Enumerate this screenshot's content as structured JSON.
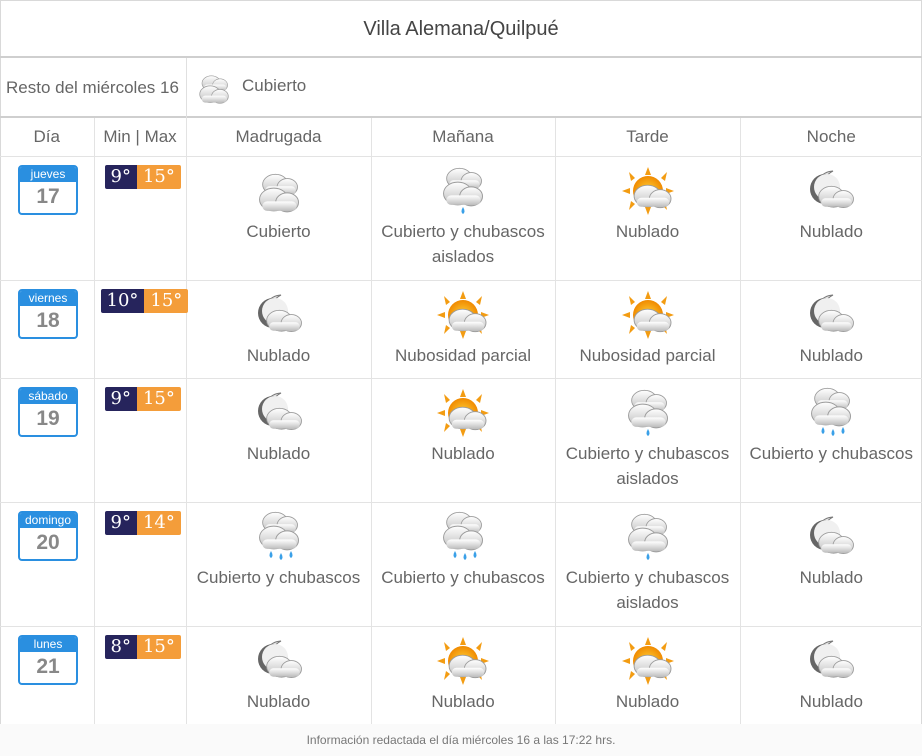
{
  "title": "Villa Alemana/Quilpué",
  "current": {
    "label": "Resto del miércoles 16",
    "condition": "Cubierto",
    "icon": "cloud-icon"
  },
  "headers": {
    "day": "Día",
    "minmax": "Min | Max",
    "madrugada": "Madrugada",
    "manana": "Mañana",
    "tarde": "Tarde",
    "noche": "Noche"
  },
  "colors": {
    "calendar": "#2a8fe0",
    "min_temp": "#26245c",
    "max_temp": "#f49d3a"
  },
  "days": [
    {
      "weekday": "jueves",
      "day": "17",
      "min": "9°",
      "max": "15°",
      "periods": [
        {
          "condition": "Cubierto",
          "icon": "cloud-icon"
        },
        {
          "condition": "Cubierto y chubascos aislados",
          "icon": "cloud-drizzle-icon"
        },
        {
          "condition": "Nublado",
          "icon": "sun-cloud-icon"
        },
        {
          "condition": "Nublado",
          "icon": "moon-cloud-icon"
        }
      ]
    },
    {
      "weekday": "viernes",
      "day": "18",
      "min": "10°",
      "max": "15°",
      "periods": [
        {
          "condition": "Nublado",
          "icon": "moon-cloud-icon"
        },
        {
          "condition": "Nubosidad parcial",
          "icon": "sun-cloud-icon"
        },
        {
          "condition": "Nubosidad parcial",
          "icon": "sun-cloud-icon"
        },
        {
          "condition": "Nublado",
          "icon": "moon-cloud-icon"
        }
      ]
    },
    {
      "weekday": "sábado",
      "day": "19",
      "min": "9°",
      "max": "15°",
      "periods": [
        {
          "condition": "Nublado",
          "icon": "moon-cloud-icon"
        },
        {
          "condition": "Nublado",
          "icon": "sun-cloud-icon"
        },
        {
          "condition": "Cubierto y chubascos aislados",
          "icon": "cloud-drizzle-icon"
        },
        {
          "condition": "Cubierto y chubascos",
          "icon": "cloud-rain-icon"
        }
      ]
    },
    {
      "weekday": "domingo",
      "day": "20",
      "min": "9°",
      "max": "14°",
      "periods": [
        {
          "condition": "Cubierto y chubascos",
          "icon": "cloud-rain-icon"
        },
        {
          "condition": "Cubierto y chubascos",
          "icon": "cloud-rain-icon"
        },
        {
          "condition": "Cubierto y chubascos aislados",
          "icon": "cloud-drizzle-icon"
        },
        {
          "condition": "Nublado",
          "icon": "moon-cloud-icon"
        }
      ]
    },
    {
      "weekday": "lunes",
      "day": "21",
      "min": "8°",
      "max": "15°",
      "periods": [
        {
          "condition": "Nublado",
          "icon": "moon-cloud-icon"
        },
        {
          "condition": "Nublado",
          "icon": "sun-cloud-icon"
        },
        {
          "condition": "Nublado",
          "icon": "sun-cloud-icon"
        },
        {
          "condition": "Nublado",
          "icon": "moon-cloud-icon"
        }
      ]
    }
  ],
  "footer": "Información redactada el día miércoles 16 a las 17:22 hrs."
}
